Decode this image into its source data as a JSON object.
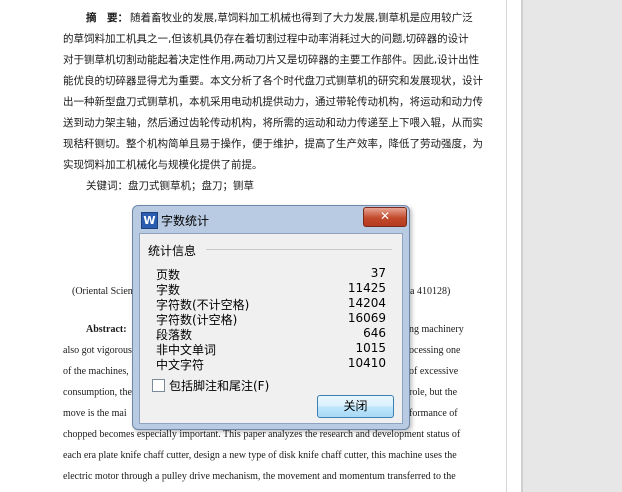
{
  "document": {
    "abstract_cn_label": "摘　要：",
    "abstract_cn_lines": [
      "随着畜牧业的发展,草饲料加工机械也得到了大力发展,铡草机是应用较广泛",
      "的草饲料加工机具之一,但该机具仍存在着切割过程中动率消耗过大的问题,切碎器的设计",
      "对于铡草机切割动能起着决定性作用,两动刀片又是切碎器的主要工作部件。因此,设计出性",
      "能优良的切碎器显得尤为重要。本文分析了各个时代盘刀式铡草机的研究和发展现状，设计",
      "出一种新型盘刀式铡草机，本机采用电动机提供动力，通过带轮传动机构，将运动和动力传",
      "送到动力架主轴，然后通过齿轮传动机构，将所需的运动和动力传递至上下喂入辊，从而实",
      "现秸秆铡切。整个机构简单且易于操作，便于维护，提高了生产效率，降低了劳动强度，为",
      "实现饲料加工机械化与规模化提供了前提。"
    ],
    "keywords_cn": "关键词：盘刀式铡草机；盘刀；铡草",
    "affiliation_left": "(Oriental Scien",
    "affiliation_right": "a 410128)",
    "abstract_en_label": "Abstract:",
    "abstract_en_right_fragments": [
      "ng machinery",
      "ocessing one",
      "of excessive",
      "role, but the",
      "formance of"
    ],
    "abstract_en_left_fragments": [
      "also got vigorous",
      "of the machines,",
      "consumption, the",
      "move is the mai"
    ],
    "abstract_en_lines_full": [
      "chopped becomes especially important. This paper analyzes the research and development status of",
      "each era plate knife chaff cutter, design a new type of disk knife chaff cutter, this machine uses the",
      "electric motor through a pulley drive mechanism, the movement and momentum transferred to the"
    ]
  },
  "dialog": {
    "title": "字数统计",
    "close_glyph": "✕",
    "group_label": "统计信息",
    "stats": [
      {
        "label": "页数",
        "value": "37"
      },
      {
        "label": "字数",
        "value": "11425"
      },
      {
        "label": "字符数(不计空格)",
        "value": "14204"
      },
      {
        "label": "字符数(计空格)",
        "value": "16069"
      },
      {
        "label": "段落数",
        "value": "646"
      },
      {
        "label": "非中文单词",
        "value": "1015"
      },
      {
        "label": "中文字符",
        "value": "10410"
      }
    ],
    "checkbox_label": "包括脚注和尾注(F)",
    "checkbox_checked": false,
    "close_button": "关闭",
    "app_icon_letter": "W"
  }
}
